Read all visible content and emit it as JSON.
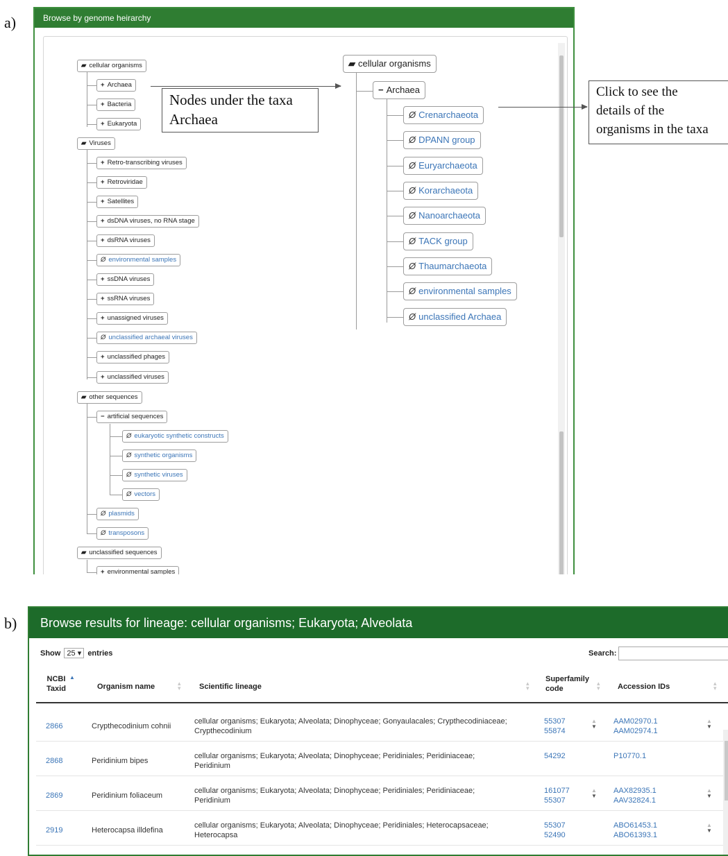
{
  "labels": {
    "a": "a)",
    "b": "b)"
  },
  "panel_a": {
    "title": "Browse by genome heirarchy",
    "left_tree": {
      "cellular_organisms": "cellular organisms",
      "archaea": "Archaea",
      "bacteria": "Bacteria",
      "eukaryota": "Eukaryota",
      "viruses": "Viruses",
      "virus_children": [
        "Retro-transcribing viruses",
        "Retroviridae",
        "Satellites",
        "dsDNA viruses, no RNA stage",
        "dsRNA viruses",
        "environmental samples",
        "ssDNA viruses",
        "ssRNA viruses",
        "unassigned viruses",
        "unclassified archaeal viruses",
        "unclassified phages",
        "unclassified viruses"
      ],
      "other_sequences": "other sequences",
      "artificial_sequences": "artificial sequences",
      "artificial_children": [
        "eukaryotic synthetic constructs",
        "synthetic organisms",
        "synthetic viruses",
        "vectors"
      ],
      "plasmids": "plasmids",
      "transposons": "transposons",
      "unclassified_sequences": "unclassified sequences",
      "unclassified_env": "environmental samples"
    },
    "right_tree": {
      "root": "cellular organisms",
      "archaea": "Archaea",
      "children": [
        "Crenarchaeota",
        "DPANN group",
        "Euryarchaeota",
        "Korarchaeota",
        "Nanoarchaeota",
        "TACK group",
        "Thaumarchaeota",
        "environmental samples",
        "unclassified Archaea"
      ]
    },
    "callout_nodes": [
      "Nodes under the taxa",
      "Archaea"
    ],
    "callout_click": [
      "Click to see the",
      "details of the",
      "organisms in the taxa"
    ],
    "colors": {
      "header": "#2f7d32",
      "leaf_link": "#3b75b7"
    }
  },
  "panel_b": {
    "title": "Browse results for lineage: cellular organisms; Eukaryota; Alveolata",
    "show_label": "Show",
    "show_value": "25",
    "entries_label": "entries",
    "search_label": "Search:",
    "columns": [
      "NCBI Taxid",
      "Organism name",
      "Scientific lineage",
      "Superfamily code",
      "Accession IDs"
    ],
    "rows": [
      {
        "taxid": "2866",
        "name": "Crypthecodinium cohnii",
        "lineage": [
          "cellular organisms; Eukaryota; Alveolata; Dinophyceae; Gonyaulacales; Crypthecodiniaceae;",
          "Crypthecodinium"
        ],
        "superfamily": [
          "55307",
          "55874"
        ],
        "accession": [
          "AAM02970.1",
          "AAM02974.1"
        ]
      },
      {
        "taxid": "2868",
        "name": "Peridinium bipes",
        "lineage": [
          "cellular organisms; Eukaryota; Alveolata; Dinophyceae; Peridiniales; Peridiniaceae;",
          "Peridinium"
        ],
        "superfamily": [
          "54292"
        ],
        "accession": [
          "P10770.1"
        ]
      },
      {
        "taxid": "2869",
        "name": "Peridinium foliaceum",
        "lineage": [
          "cellular organisms; Eukaryota; Alveolata; Dinophyceae; Peridiniales; Peridiniaceae;",
          "Peridinium"
        ],
        "superfamily": [
          "161077",
          "55307"
        ],
        "accession": [
          "AAX82935.1",
          "AAV32824.1"
        ]
      },
      {
        "taxid": "2919",
        "name": "Heterocapsa illdefina",
        "lineage": [
          "cellular organisms; Eukaryota; Alveolata; Dinophyceae; Peridiniales; Heterocapsaceae;",
          "Heterocapsa"
        ],
        "superfamily": [
          "55307",
          "52490"
        ],
        "accession": [
          "ABO61453.1",
          "ABO61393.1"
        ]
      }
    ],
    "colors": {
      "header": "#1d6b2a",
      "link": "#3b75b7"
    }
  }
}
